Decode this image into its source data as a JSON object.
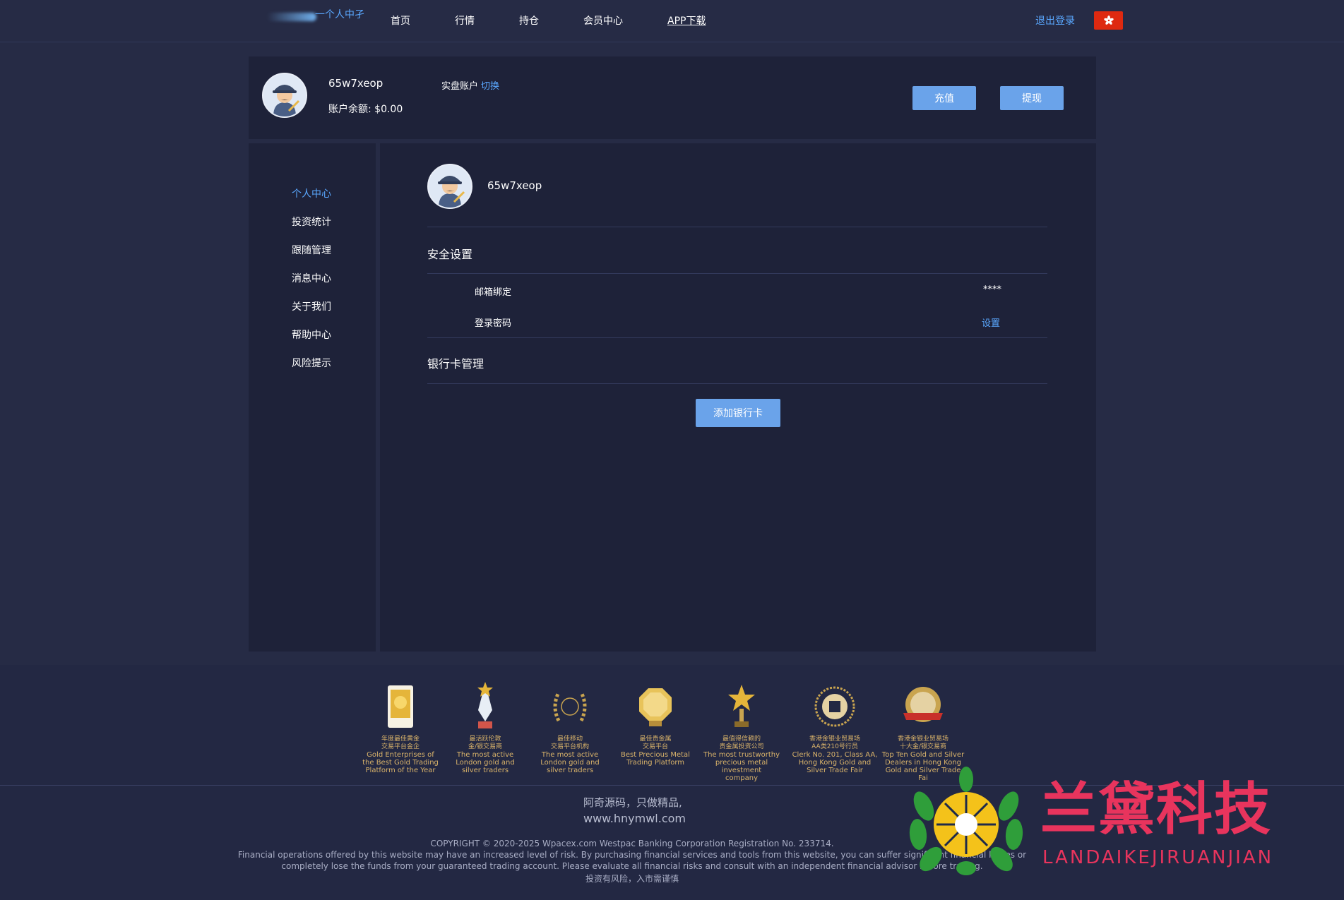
{
  "nav": {
    "logo_text": "一个人中孑",
    "items": [
      "首页",
      "行情",
      "持仓",
      "会员中心",
      "APP下载"
    ],
    "logout": "退出登录",
    "flag_icon": "hong-kong-flag-icon"
  },
  "user_card": {
    "username": "65w7xeop",
    "balance_label": "账户余额: $0.00",
    "account_type": "实盘账户",
    "switch_label": "切换",
    "deposit_label": "充值",
    "withdraw_label": "提现"
  },
  "sidebar": {
    "items": [
      "个人中心",
      "投资统计",
      "跟随管理",
      "消息中心",
      "关于我们",
      "帮助中心",
      "风险提示"
    ],
    "active": "个人中心"
  },
  "main": {
    "username": "65w7xeop",
    "security_title": "安全设置",
    "rows": [
      {
        "label": "邮箱绑定",
        "value": "****"
      },
      {
        "label": "登录密码",
        "value": "设置"
      }
    ],
    "bank_title": "银行卡管理",
    "add_card_label": "添加银行卡"
  },
  "footer": {
    "awards": [
      {
        "cn": "年度最佳黄金\n交易平台金企",
        "en": "Gold Enterprises of\nthe Best Gold Trading\nPlatform of the Year"
      },
      {
        "cn": "最活跃伦敦\n金/银交易商",
        "en": "The most active\nLondon gold and\nsilver traders"
      },
      {
        "cn": "最佳移动\n交易平台机构",
        "en": "The most active\nLondon gold and\nsilver traders"
      },
      {
        "cn": "最佳贵金属\n交易平台",
        "en": "Best Precious Metal\nTrading Platform"
      },
      {
        "cn": "最值得信赖的\n贵金属投资公司",
        "en": "The most trustworthy\nprecious metal investment\ncompany"
      },
      {
        "cn": "香港金银业贸易场\nAA类210号行员",
        "en": "Clerk No. 201, Class AA,\nHong Kong Gold and\nSilver Trade Fair"
      },
      {
        "cn": "香港金银业贸易场\n十大金/银交易商",
        "en": "Top Ten Gold and Silver\nDealers in Hong Kong\nGold and Silver Trade Fai"
      }
    ],
    "slogan": "阿奇源码，只做精品,",
    "site": "www.hnymwl.com",
    "copyright": "COPYRIGHT © 2020-2025 Wpacex.com Westpac Banking Corporation Registration No. 233714.",
    "risk_line1": "Financial operations offered by this website may have an increased level of risk. By purchasing financial services and tools from this website, you can suffer significant financial losses or",
    "risk_line2": "completely lose the funds from your guaranteed trading account. Please evaluate all financial risks and consult with an independent financial advisor before trading.",
    "risk_cn": "投资有风险，入市需谨慎",
    "watermark_text": "兰黛科技",
    "watermark_sub": "LANDAIKEJIRUANJIAN"
  }
}
